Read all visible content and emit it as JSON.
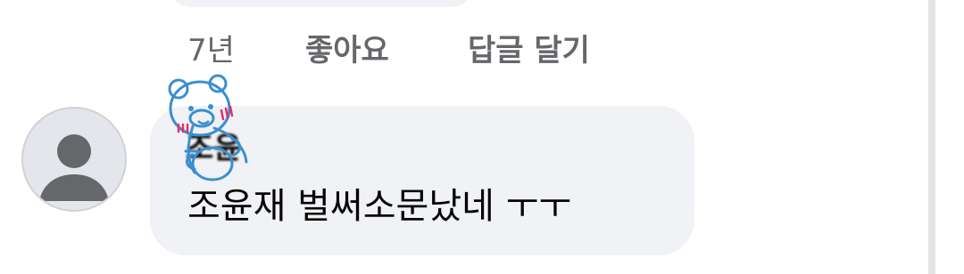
{
  "comment": {
    "time": "7년",
    "like_label": "좋아요",
    "reply_label": "답글 달기",
    "author": "조윤",
    "text": "조윤재 벌써소문났네 ㅜㅜ"
  },
  "avatar": {
    "icon": "default-profile-icon"
  },
  "sticker": {
    "icon": "bear-doodle-icon"
  },
  "colors": {
    "bubble": "#f0f2f5",
    "meta_text": "#65676b",
    "text": "#050505",
    "sticker_stroke": "#3a8fd0",
    "sticker_blush": "#e0306a"
  }
}
